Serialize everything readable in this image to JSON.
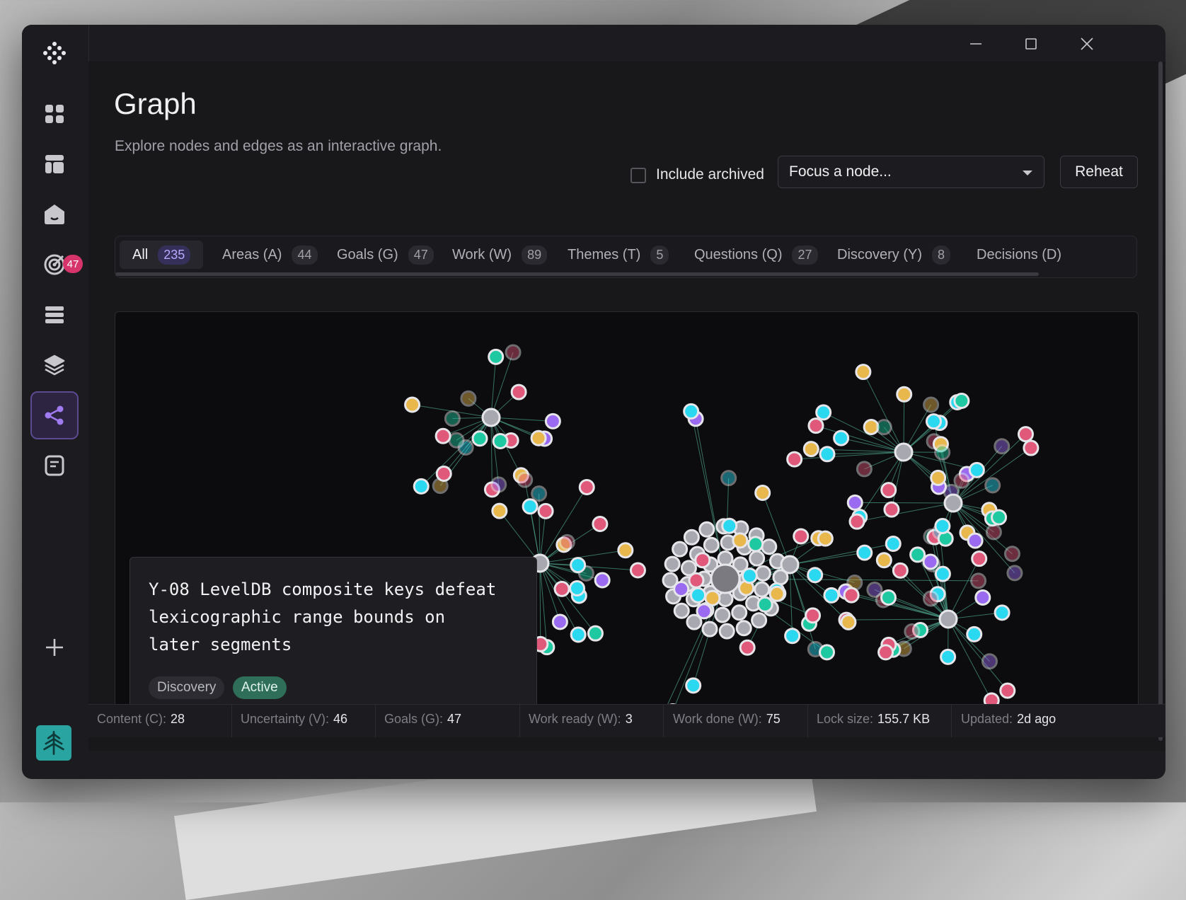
{
  "app": {
    "sidebar": [
      {
        "icon": "grid-icon"
      },
      {
        "icon": "layout-icon"
      },
      {
        "icon": "home-icon"
      },
      {
        "icon": "target-icon",
        "badge": "47"
      },
      {
        "icon": "list-icon"
      },
      {
        "icon": "layers-icon"
      },
      {
        "icon": "share-graph-icon",
        "active": true
      },
      {
        "icon": "note-icon"
      }
    ],
    "add_icon": "plus-icon",
    "avatar_icon": "tree-icon"
  },
  "page": {
    "title": "Graph",
    "subtitle": "Explore nodes and edges as an interactive graph.",
    "include_archived_label": "Include archived",
    "include_archived_checked": false,
    "focus_placeholder": "Focus a node...",
    "reheat_label": "Reheat"
  },
  "tabs": [
    {
      "label": "All",
      "count": "235",
      "active": true
    },
    {
      "label": "Areas (A)",
      "count": "44"
    },
    {
      "label": "Goals (G)",
      "count": "47"
    },
    {
      "label": "Work (W)",
      "count": "89"
    },
    {
      "label": "Themes (T)",
      "count": "5"
    },
    {
      "label": "Questions (Q)",
      "count": "27"
    },
    {
      "label": "Discovery (Y)",
      "count": "8"
    },
    {
      "label": "Decisions (D)",
      "count": ""
    }
  ],
  "tooltip": {
    "title": "Y-08 LevelDB composite keys defeat lexicographic range bounds on later segments",
    "type_tag": "Discovery",
    "status_tag": "Active"
  },
  "status": [
    {
      "key": "Content (C):",
      "value": "28"
    },
    {
      "key": "Uncertainty (V):",
      "value": "46"
    },
    {
      "key": "Goals (G):",
      "value": "47"
    },
    {
      "key": "Work ready (W):",
      "value": "3"
    },
    {
      "key": "Work done (W):",
      "value": "75"
    },
    {
      "key": "Lock size:",
      "value": "155.7 KB"
    },
    {
      "key": "Updated:",
      "value": "2d ago"
    }
  ],
  "colors": {
    "area": "#1ec8a0",
    "goal": "#e8b84c",
    "work": "#9a6bf0",
    "theme": "#2ad8f0",
    "question": "#e0587a",
    "discovery": "#7a8a94",
    "hub": "#a8a8b0",
    "edge": "#4fa890",
    "accent": "#8a6ae0"
  }
}
